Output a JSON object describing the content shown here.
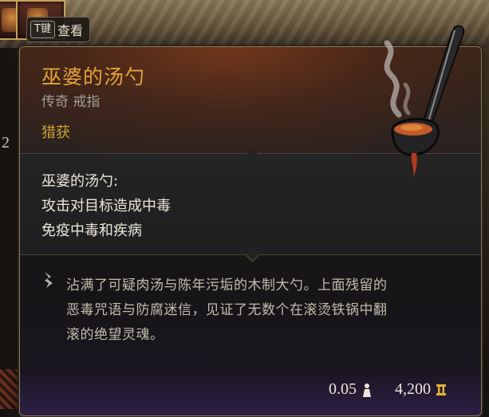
{
  "key_hint": {
    "key": "T键",
    "label": "查看"
  },
  "sidebar": {
    "count": "2"
  },
  "tooltip": {
    "title": "巫婆的汤勺",
    "subtitle": "传奇 戒指",
    "source": "猎获",
    "effects": [
      "巫婆的汤勺:",
      "攻击对目标造成中毒",
      "免疫中毒和疾病"
    ],
    "lore_icon": "feather-quill-icon",
    "lore_lines": [
      "沾满了可疑肉汤与陈年污垢的木制大勺。上面残留的",
      "恶毒咒语与防腐迷信，见证了无数个在滚烫铁锅中翻",
      "滚的绝望灵魂。"
    ],
    "weight": "0.05",
    "weight_icon": "weight-icon",
    "value": "4,200",
    "value_icon": "gold-coin-icon",
    "item_icon": "ladle-icon"
  },
  "colors": {
    "title": "#e4a338",
    "source": "#c8a232",
    "subtitle": "#a39f94",
    "effect_text": "#ece6da",
    "lore_text": "#c2bcae"
  }
}
